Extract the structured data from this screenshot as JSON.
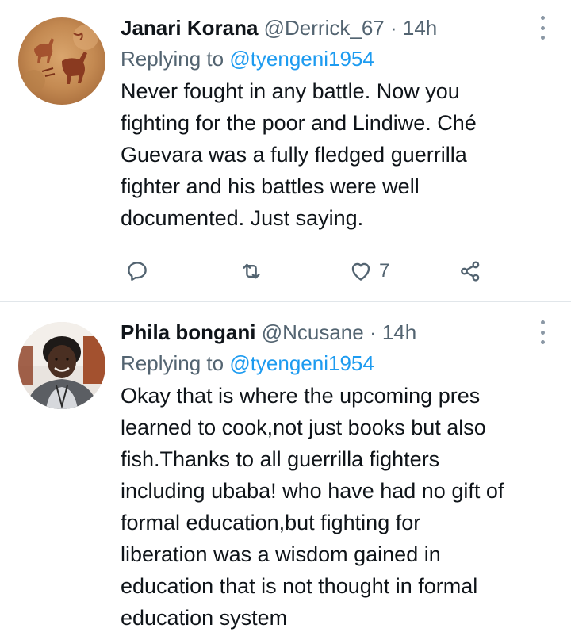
{
  "tweets": [
    {
      "name": "Janari Korana",
      "handle": "@Derrick_67",
      "separator": "·",
      "time": "14h",
      "replying_prefix": "Replying to ",
      "replying_to": "@tyengeni1954",
      "text": "Never fought in any battle. Now you\nfighting for the poor and Lindiwe. Ché\nGuevara was a fully fledged guerrilla\nfighter and his battles were well\ndocumented. Just saying.",
      "like_count": "7",
      "avatar_icon": "rock-art-avatar"
    },
    {
      "name": "Phila bongani",
      "handle": "@Ncusane",
      "separator": "·",
      "time": "14h",
      "replying_prefix": "Replying to ",
      "replying_to": "@tyengeni1954",
      "text": "Okay that is where the upcoming pres\nlearned to cook,not just books but also\nfish.Thanks to all guerrilla fighters\nincluding ubaba! who have had no gift of\nformal education,but fighting for\nliberation was a wisdom gained in\neducation that is not thought in formal\neducation system",
      "avatar_icon": "person-photo-avatar"
    }
  ],
  "icons": {
    "reply": "reply-icon",
    "retweet": "retweet-icon",
    "like": "heart-icon",
    "share": "share-icon",
    "more": "more-vertical-icon"
  },
  "colors": {
    "text": "#0f1419",
    "secondary": "#536471",
    "link": "#1d9bf0",
    "divider": "#e1e6ea",
    "icon": "#536471"
  }
}
